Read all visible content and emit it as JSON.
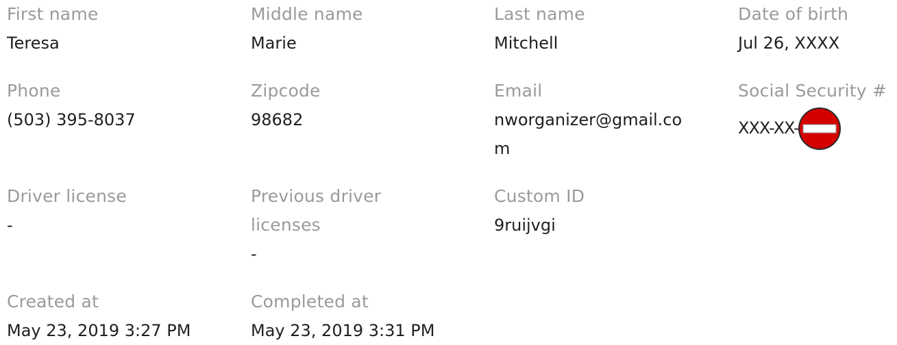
{
  "fields": {
    "first_name": {
      "label": "First name",
      "value": "Teresa"
    },
    "middle_name": {
      "label": "Middle name",
      "value": "Marie"
    },
    "last_name": {
      "label": "Last name",
      "value": "Mitchell"
    },
    "date_of_birth": {
      "label": "Date of birth",
      "value": "Jul 26, XXXX"
    },
    "phone": {
      "label": "Phone",
      "value": "(503) 395-8037"
    },
    "zipcode": {
      "label": "Zipcode",
      "value": "98682"
    },
    "email": {
      "label": "Email",
      "value": "nworganizer@gmail.com"
    },
    "ssn": {
      "label": "Social Security #",
      "value": "XXX-XX-",
      "redaction_icon": "no-entry-icon"
    },
    "driver_license": {
      "label": "Driver license",
      "value": "-"
    },
    "previous_driver_licenses": {
      "label": "Previous driver licenses",
      "value": "-"
    },
    "custom_id": {
      "label": "Custom ID",
      "value": "9ruijvgi"
    },
    "created_at": {
      "label": "Created at",
      "value": "May 23, 2019 3:27 PM"
    },
    "completed_at": {
      "label": "Completed at",
      "value": "May 23, 2019 3:31 PM"
    }
  },
  "colors": {
    "label": "#9a9a9a",
    "value": "#1f1f1f",
    "redaction_red": "#d40000"
  }
}
